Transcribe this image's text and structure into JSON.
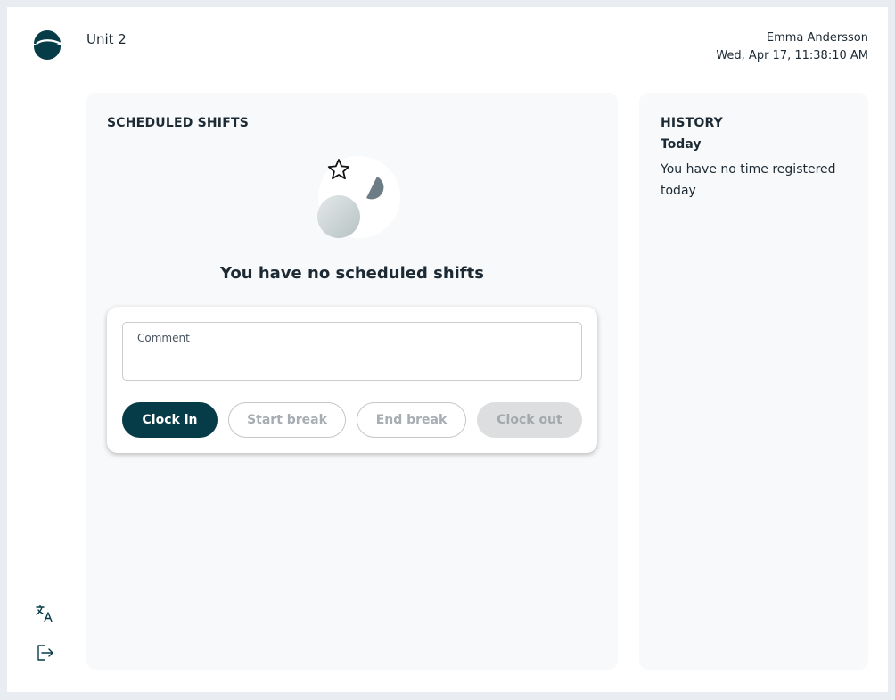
{
  "header": {
    "unit_title": "Unit 2",
    "user_name": "Emma Andersson",
    "datetime": "Wed, Apr 17, 11:38:10 AM"
  },
  "icons": {
    "logo": "brand-logo-icon",
    "translate": "translate-icon",
    "logout": "logout-icon",
    "star": "star-icon"
  },
  "scheduled": {
    "title": "SCHEDULED SHIFTS",
    "empty_message": "You have no scheduled shifts"
  },
  "clock_card": {
    "comment_label": "Comment",
    "comment_value": "",
    "buttons": {
      "clock_in": "Clock in",
      "start_break": "Start break",
      "end_break": "End break",
      "clock_out": "Clock out"
    }
  },
  "history": {
    "title": "HISTORY",
    "day_label": "Today",
    "empty_message": "You have no time registered today"
  },
  "colors": {
    "brand": "#063c48",
    "panel_bg": "#f7f9fb",
    "disabled_bg": "#dcdedf"
  }
}
